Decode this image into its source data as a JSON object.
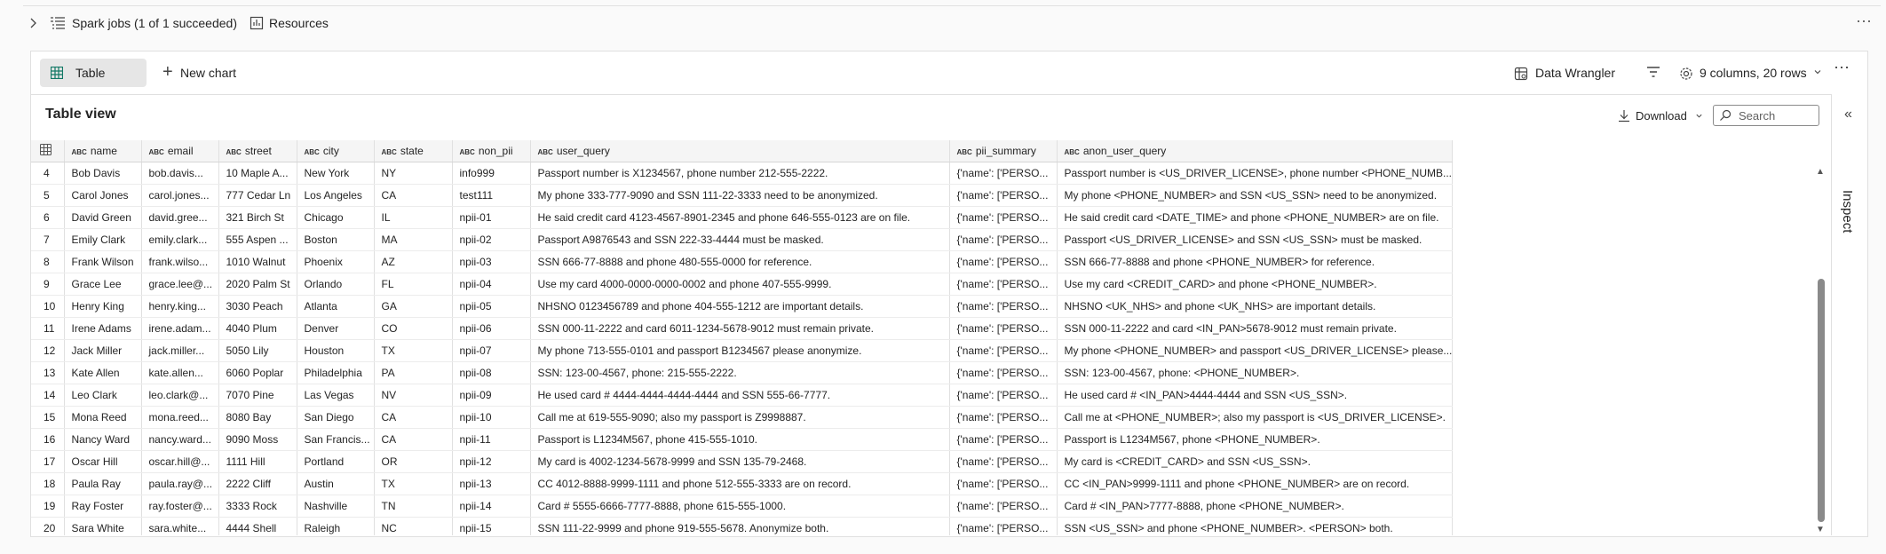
{
  "spark": {
    "jobs_label": "Spark jobs (1 of 1 succeeded)",
    "resources_label": "Resources"
  },
  "toolbar": {
    "table_tab": "Table",
    "new_chart": "New chart",
    "data_wrangler": "Data Wrangler",
    "columns_rows": "9 columns, 20 rows"
  },
  "table_view": {
    "title": "Table view",
    "download": "Download",
    "search_placeholder": "Search",
    "inspect": "Inspect"
  },
  "columns": [
    "name",
    "email",
    "street",
    "city",
    "state",
    "non_pii",
    "user_query",
    "pii_summary",
    "anon_user_query"
  ],
  "rows": [
    [
      "4",
      "Bob Davis",
      "bob.davis...",
      "10 Maple A...",
      "New York",
      "NY",
      "info999",
      "Passport number is X1234567, phone number 212-555-2222.",
      "{'name': ['PERSO...",
      "Passport number is <US_DRIVER_LICENSE>, phone number <PHONE_NUMB..."
    ],
    [
      "5",
      "Carol Jones",
      "carol.jones...",
      "777 Cedar Ln",
      "Los Angeles",
      "CA",
      "test111",
      "My phone 333-777-9090 and SSN 111-22-3333 need to be anonymized.",
      "{'name': ['PERSO...",
      "My phone <PHONE_NUMBER> and SSN <US_SSN> need to be anonymized."
    ],
    [
      "6",
      "David Green",
      "david.gree...",
      "321 Birch St",
      "Chicago",
      "IL",
      "npii-01",
      "He said credit card 4123-4567-8901-2345 and phone 646-555-0123 are on file.",
      "{'name': ['PERSO...",
      "He said credit card <DATE_TIME> and phone <PHONE_NUMBER> are on file."
    ],
    [
      "7",
      "Emily Clark",
      "emily.clark...",
      "555 Aspen ...",
      "Boston",
      "MA",
      "npii-02",
      "Passport A9876543 and SSN 222-33-4444 must be masked.",
      "{'name': ['PERSO...",
      "Passport <US_DRIVER_LICENSE> and SSN <US_SSN> must be masked."
    ],
    [
      "8",
      "Frank Wilson",
      "frank.wilso...",
      "1010 Walnut",
      "Phoenix",
      "AZ",
      "npii-03",
      "SSN 666-77-8888 and phone 480-555-0000 for reference.",
      "{'name': ['PERSO...",
      "SSN 666-77-8888 and phone <PHONE_NUMBER> for reference."
    ],
    [
      "9",
      "Grace Lee",
      "grace.lee@...",
      "2020 Palm St",
      "Orlando",
      "FL",
      "npii-04",
      "Use my card 4000-0000-0000-0002 and phone 407-555-9999.",
      "{'name': ['PERSO...",
      "Use my card <CREDIT_CARD> and phone <PHONE_NUMBER>."
    ],
    [
      "10",
      "Henry King",
      "henry.king...",
      "3030 Peach",
      "Atlanta",
      "GA",
      "npii-05",
      "NHSNO 0123456789 and phone 404-555-1212 are important details.",
      "{'name': ['PERSO...",
      "NHSNO <UK_NHS> and phone <UK_NHS> are important details."
    ],
    [
      "11",
      "Irene Adams",
      "irene.adam...",
      "4040 Plum",
      "Denver",
      "CO",
      "npii-06",
      "SSN 000-11-2222 and card 6011-1234-5678-9012 must remain private.",
      "{'name': ['PERSO...",
      "SSN 000-11-2222 and card <IN_PAN>5678-9012 must remain private."
    ],
    [
      "12",
      "Jack Miller",
      "jack.miller...",
      "5050 Lily",
      "Houston",
      "TX",
      "npii-07",
      "My phone 713-555-0101 and passport B1234567 please anonymize.",
      "{'name': ['PERSO...",
      "My phone <PHONE_NUMBER> and passport <US_DRIVER_LICENSE> please..."
    ],
    [
      "13",
      "Kate Allen",
      "kate.allen...",
      "6060 Poplar",
      "Philadelphia",
      "PA",
      "npii-08",
      "SSN: 123-00-4567, phone: 215-555-2222.",
      "{'name': ['PERSO...",
      "SSN: 123-00-4567, phone: <PHONE_NUMBER>."
    ],
    [
      "14",
      "Leo Clark",
      "leo.clark@...",
      "7070 Pine",
      "Las Vegas",
      "NV",
      "npii-09",
      "He used card # 4444-4444-4444-4444 and SSN 555-66-7777.",
      "{'name': ['PERSO...",
      "He used card # <IN_PAN>4444-4444 and SSN <US_SSN>."
    ],
    [
      "15",
      "Mona Reed",
      "mona.reed...",
      "8080 Bay",
      "San Diego",
      "CA",
      "npii-10",
      "Call me at 619-555-9090; also my passport is Z9998887.",
      "{'name': ['PERSO...",
      "Call me at <PHONE_NUMBER>; also my passport is <US_DRIVER_LICENSE>."
    ],
    [
      "16",
      "Nancy Ward",
      "nancy.ward...",
      "9090 Moss",
      "San Francis...",
      "CA",
      "npii-11",
      "Passport is L1234M567, phone 415-555-1010.",
      "{'name': ['PERSO...",
      "Passport is L1234M567, phone <PHONE_NUMBER>."
    ],
    [
      "17",
      "Oscar Hill",
      "oscar.hill@...",
      "1111 Hill",
      "Portland",
      "OR",
      "npii-12",
      "My card is 4002-1234-5678-9999 and SSN 135-79-2468.",
      "{'name': ['PERSO...",
      "My card is <CREDIT_CARD> and SSN <US_SSN>."
    ],
    [
      "18",
      "Paula Ray",
      "paula.ray@...",
      "2222 Cliff",
      "Austin",
      "TX",
      "npii-13",
      "CC 4012-8888-9999-1111 and phone 512-555-3333 are on record.",
      "{'name': ['PERSO...",
      "CC <IN_PAN>9999-1111 and phone <PHONE_NUMBER> are on record."
    ],
    [
      "19",
      "Ray Foster",
      "ray.foster@...",
      "3333 Rock",
      "Nashville",
      "TN",
      "npii-14",
      "Card # 5555-6666-7777-8888, phone 615-555-1000.",
      "{'name': ['PERSO...",
      "Card # <IN_PAN>7777-8888, phone <PHONE_NUMBER>."
    ],
    [
      "20",
      "Sara White",
      "sara.white...",
      "4444 Shell",
      "Raleigh",
      "NC",
      "npii-15",
      "SSN 111-22-9999 and phone 919-555-5678. Anonymize both.",
      "{'name': ['PERSO...",
      "SSN <US_SSN> and phone <PHONE_NUMBER>. <PERSON> both."
    ]
  ],
  "colors": {
    "accent": "#117865",
    "border": "#e0e0e0",
    "header_bg": "#f5f5f5"
  },
  "icons": [
    "chevron-right-icon",
    "spark-jobs-icon",
    "resources-icon",
    "table-grid-icon",
    "plus-icon",
    "data-wrangler-icon",
    "filter-icon",
    "gear-icon",
    "more-icon",
    "download-icon",
    "search-icon",
    "collapse-icon"
  ]
}
